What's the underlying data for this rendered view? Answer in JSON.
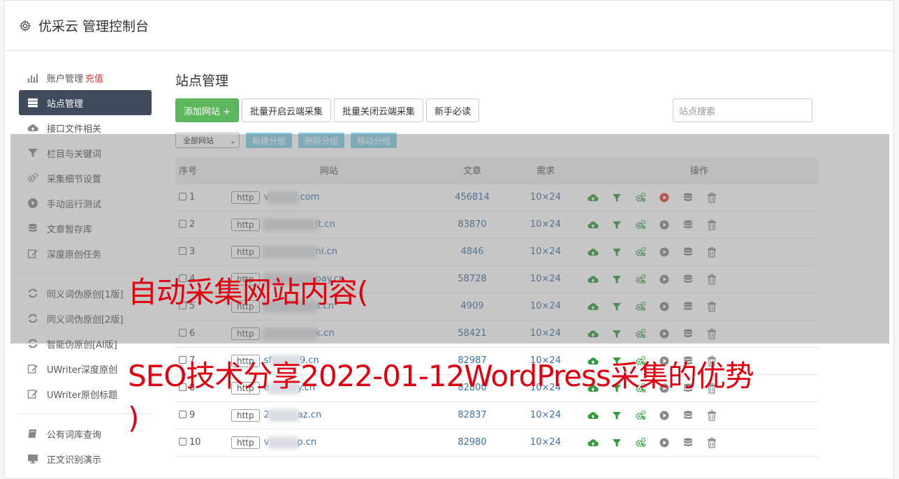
{
  "header": {
    "title": "优采云 管理控制台"
  },
  "sidebar": {
    "items": [
      {
        "label": "账户管理",
        "extra": "充值",
        "icon": "bar-chart-icon"
      },
      {
        "label": "站点管理",
        "icon": "server-icon",
        "active": true
      },
      {
        "label": "接口文件相关",
        "icon": "cloud-upload-icon"
      },
      {
        "label": "栏目与关键词",
        "icon": "filter-icon"
      },
      {
        "label": "采集细节设置",
        "icon": "gears-icon"
      },
      {
        "label": "手动运行测试",
        "icon": "play-icon"
      },
      {
        "label": "文章暂存库",
        "icon": "database-icon"
      },
      {
        "label": "深度原创任务",
        "icon": "edit-icon"
      }
    ],
    "items2": [
      {
        "label": "同义词伪原创[1版]",
        "icon": "refresh-icon"
      },
      {
        "label": "同义词伪原创[2版]",
        "icon": "refresh-icon"
      },
      {
        "label": "智能伪原创[AI版]",
        "icon": "refresh-icon"
      },
      {
        "label": "UWriter深度原创",
        "icon": "edit-icon"
      },
      {
        "label": "UWriter原创标题",
        "icon": "edit-icon"
      }
    ],
    "items3": [
      {
        "label": "公有词库查询",
        "icon": "book-icon"
      },
      {
        "label": "正文识别演示",
        "icon": "monitor-icon"
      }
    ]
  },
  "main": {
    "title": "站点管理",
    "toolbar": {
      "add_site": "添加网站 +",
      "batch_open": "批量开启云端采集",
      "batch_close": "批量关闭云端采集",
      "newbie": "新手必读",
      "search_placeholder": "站点搜索"
    },
    "group_bar": {
      "select_value": "全部网站",
      "new_group": "新建分组",
      "delete_group": "删除分组",
      "move_group": "移动分组"
    },
    "table": {
      "headers": [
        "序号",
        "网站",
        "文章",
        "需求",
        "操作"
      ],
      "rows": [
        {
          "no": "1",
          "http": "http",
          "prefix": "v",
          "suffix": ".com",
          "articles": "456814",
          "demand": "10×24",
          "running": true
        },
        {
          "no": "2",
          "http": "http",
          "prefix": "",
          "suffix": "lt.cn",
          "articles": "83870",
          "demand": "10×24",
          "running": false
        },
        {
          "no": "3",
          "http": "http",
          "prefix": "",
          "suffix": "ni.cn",
          "articles": "4846",
          "demand": "10×24",
          "running": false
        },
        {
          "no": "4",
          "http": "http",
          "prefix": "",
          "suffix": "pay.cn",
          "articles": "58728",
          "demand": "10×24",
          "running": false
        },
        {
          "no": "5",
          "http": "http",
          "prefix": "",
          "suffix": "s.cn",
          "articles": "4909",
          "demand": "10×24",
          "running": false
        },
        {
          "no": "6",
          "http": "http",
          "prefix": "",
          "suffix": "k.cn",
          "articles": "58421",
          "demand": "10×24",
          "running": false
        },
        {
          "no": "7",
          "http": "http",
          "prefix": "sf",
          "suffix": "9.cn",
          "articles": "82987",
          "demand": "10×24",
          "running": false
        },
        {
          "no": "8",
          "http": "http",
          "prefix": "e",
          "suffix": "y.cn",
          "articles": "82800",
          "demand": "10×24",
          "running": false
        },
        {
          "no": "9",
          "http": "http",
          "prefix": "2",
          "suffix": "az.cn",
          "articles": "82837",
          "demand": "10×24",
          "running": false
        },
        {
          "no": "10",
          "http": "http",
          "prefix": "v",
          "suffix": "p.cn",
          "articles": "82980",
          "demand": "10×24",
          "running": false
        }
      ]
    }
  },
  "overlay_text": {
    "line1": "自动采集网站内容(",
    "line2": "SEO技术分享2022-01-12WordPress采集的优势",
    "line3": ")"
  },
  "colors": {
    "accent_green": "#5cb85c",
    "sidebar_active": "#3f4a5d",
    "red_text": "#e0000f",
    "link_blue": "#3a6fa8"
  }
}
